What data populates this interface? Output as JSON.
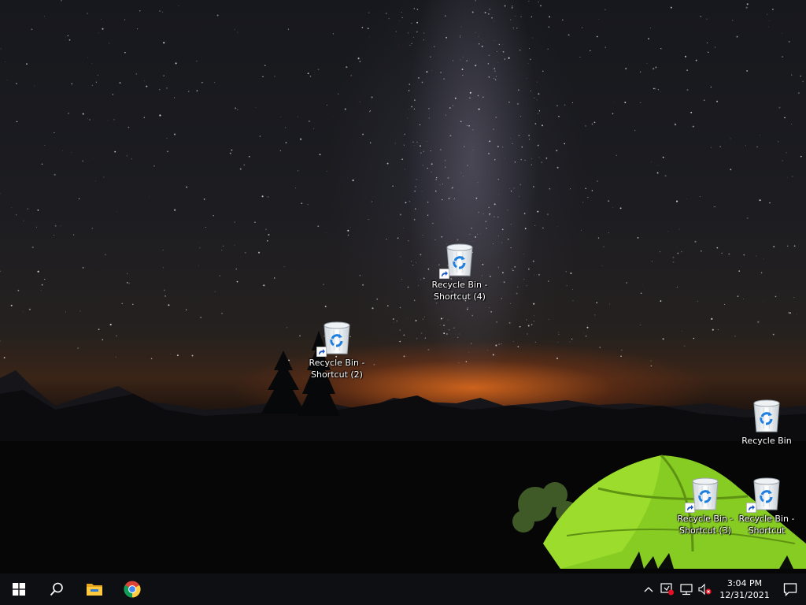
{
  "desktop": {
    "icons": [
      {
        "label": "Recycle Bin -\nShortcut (4)",
        "shortcut": true
      },
      {
        "label": "Recycle Bin -\nShortcut (2)",
        "shortcut": true
      },
      {
        "label": "Recycle Bin",
        "shortcut": false
      },
      {
        "label": "Recycle Bin -\nShortcut (3)",
        "shortcut": true
      },
      {
        "label": "Recycle Bin -\nShortcut",
        "shortcut": true
      }
    ]
  },
  "taskbar": {
    "start_icon": "windows-logo-icon",
    "search_icon": "search-icon",
    "pinned": [
      "file-explorer-icon",
      "chrome-icon"
    ],
    "tray": {
      "icons": [
        "chevron-up-icon",
        "security-alert-icon",
        "network-icon",
        "volume-muted-icon"
      ],
      "time": "3:04 PM",
      "date": "12/31/2021"
    },
    "notification_icon": "action-center-icon"
  },
  "colors": {
    "taskbar": "#0e0f12",
    "tent": "#7ac21a",
    "sky_glow": "#e86e1e",
    "windows_blue": "#1e88e5"
  }
}
